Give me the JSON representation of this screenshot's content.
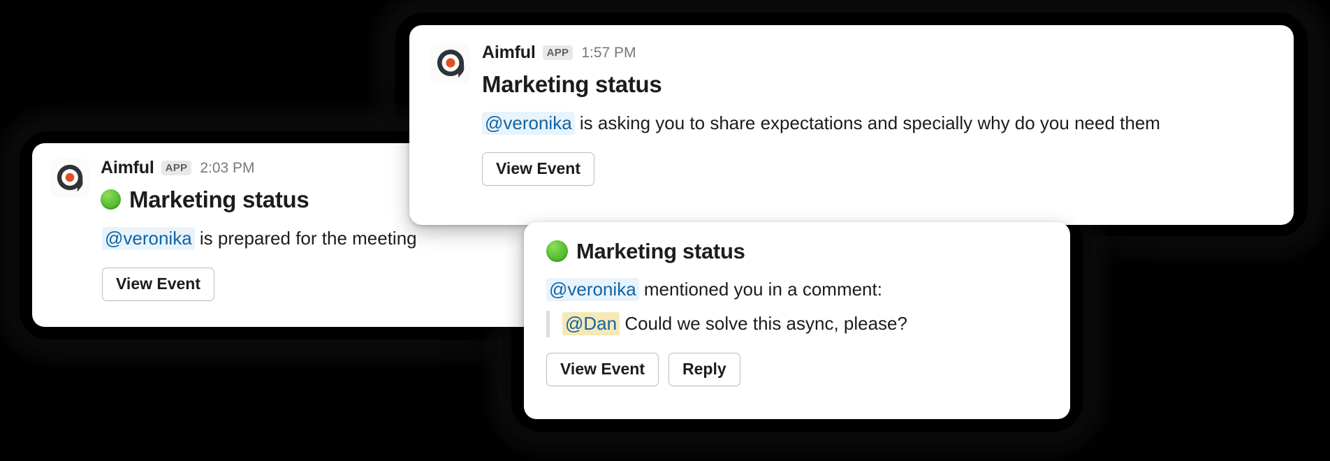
{
  "theme": {
    "background": "#000000",
    "card_background": "#ffffff",
    "text_color": "#1d1c1d",
    "mention_color": "#1264a3",
    "mention_background": "#e8f3fb",
    "mention_quote_background": "#f5e9b8",
    "badge_background": "#e8e8e8",
    "badge_text": "#616061",
    "timestamp_color": "#787878",
    "button_border": "#bdbdbd",
    "logo_dark": "#2e3338",
    "logo_dot": "#e14f26",
    "status_green": "#63c73a"
  },
  "app": {
    "name": "Aimful",
    "badge": "APP",
    "logo_icon": "aimful-logo-icon"
  },
  "cards": [
    {
      "id": "card-top",
      "app_name": "Aimful",
      "badge": "APP",
      "timestamp": "1:57 PM",
      "title": "Marketing status",
      "has_status_emoji": false,
      "status_emoji": "",
      "mention": "@veronika",
      "message": " is asking you to share expectations and specially why do you need them",
      "buttons": [
        {
          "label": "View Event",
          "name": "view-event-button"
        }
      ]
    },
    {
      "id": "card-left",
      "app_name": "Aimful",
      "badge": "APP",
      "timestamp": "2:03 PM",
      "title": "Marketing status",
      "has_status_emoji": true,
      "status_emoji": "green-circle-emoji",
      "mention": "@veronika",
      "message": " is prepared for the meeting",
      "buttons": [
        {
          "label": "View Event",
          "name": "view-event-button"
        }
      ]
    },
    {
      "id": "card-bottom",
      "title": "Marketing status",
      "has_status_emoji": true,
      "status_emoji": "green-circle-emoji",
      "mention": "@veronika",
      "message": " mentioned you in a comment:",
      "quote": {
        "mention": "@Dan",
        "text": " Could we solve this async, please?"
      },
      "buttons": [
        {
          "label": "View Event",
          "name": "view-event-button"
        },
        {
          "label": "Reply",
          "name": "reply-button"
        }
      ]
    }
  ]
}
